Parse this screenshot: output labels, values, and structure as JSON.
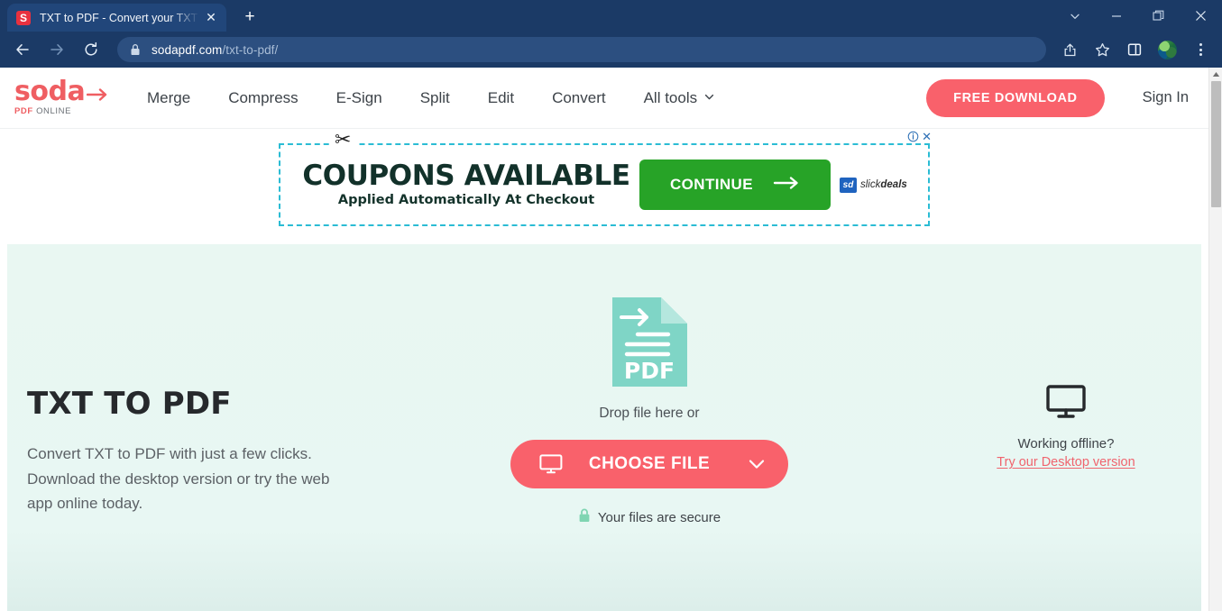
{
  "browser": {
    "tab": {
      "favicon_letter": "S",
      "title": "TXT to PDF - Convert your TXT to",
      "close_glyph": "✕"
    },
    "new_tab_label": "+",
    "window_controls": {
      "tab_search": "chevron-down-icon",
      "minimize": "minimize-icon",
      "maximize": "maximize-icon",
      "close": "close-icon"
    },
    "toolbar": {
      "back": "back-arrow-icon",
      "forward": "forward-arrow-icon",
      "reload": "reload-icon",
      "url_domain": "sodapdf.com",
      "url_path": "/txt-to-pdf/",
      "lock": "lock-icon",
      "share": "share-icon",
      "bookmark": "star-icon",
      "side_panel": "side-panel-icon",
      "profile": "profile-avatar",
      "menu": "three-dot-menu-icon"
    }
  },
  "site": {
    "logo": {
      "word": "soda",
      "sub_accent": "PDF",
      "sub_rest": "ONLINE"
    },
    "nav": [
      {
        "label": "Merge",
        "has_caret": false
      },
      {
        "label": "Compress",
        "has_caret": false
      },
      {
        "label": "E-Sign",
        "has_caret": false
      },
      {
        "label": "Split",
        "has_caret": false
      },
      {
        "label": "Edit",
        "has_caret": false
      },
      {
        "label": "Convert",
        "has_caret": false
      },
      {
        "label": "All tools",
        "has_caret": true
      }
    ],
    "free_download": "FREE DOWNLOAD",
    "sign_in": "Sign In"
  },
  "ad": {
    "headline": "COUPONS AVAILABLE",
    "subline": "Applied Automatically At Checkout",
    "cta": "CONTINUE",
    "brand_badge": "sd",
    "brand_name_light": "slick",
    "brand_name_bold": "deals",
    "close_glyph": "✕",
    "info_glyph": "i"
  },
  "hero": {
    "title": "TXT TO PDF",
    "description": "Convert TXT to PDF with just a few clicks. Download the desktop version or try the web app online today.",
    "file_icon_label": "PDF",
    "drop_text": "Drop file here or",
    "choose_file": "CHOOSE FILE",
    "secure_text": "Your files are secure",
    "offline_label": "Working offline?",
    "offline_link": "Try our Desktop version"
  },
  "colors": {
    "brand_red": "#f9616b",
    "hero_bg": "#e9f7f2",
    "pdf_icon_teal": "#7fd5c6",
    "ad_border": "#2bbcd4",
    "ad_cta_green": "#27a327",
    "chrome_blue": "#1b3a66"
  }
}
